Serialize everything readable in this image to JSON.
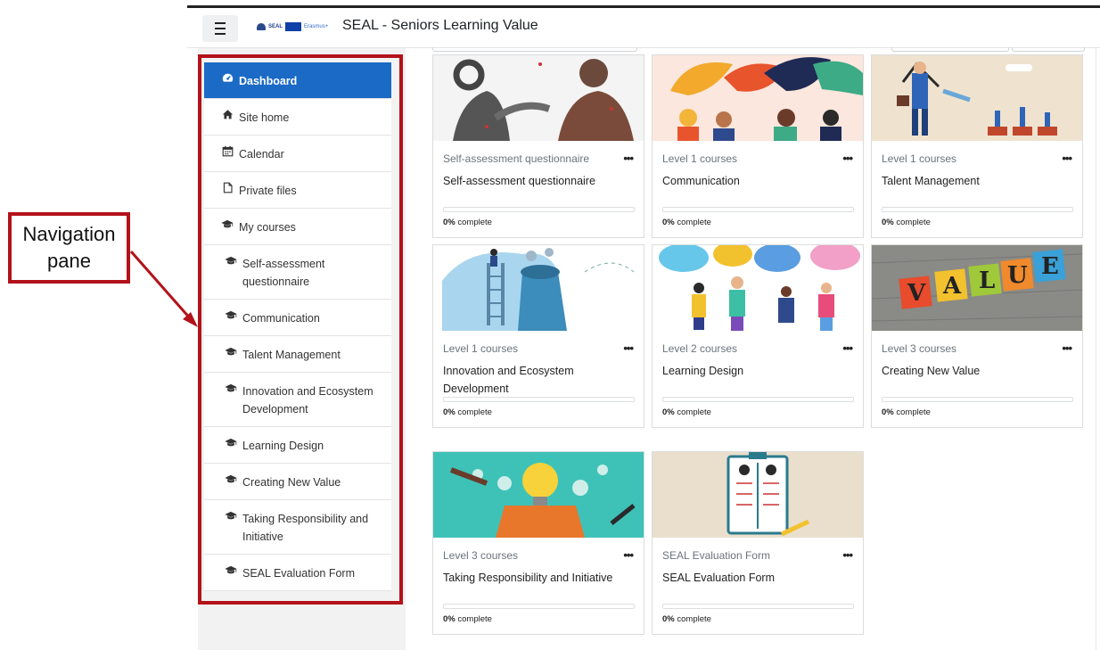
{
  "annotation": {
    "label": "Navigation\npane"
  },
  "header": {
    "menu_icon": "hamburger-icon",
    "site_title": "SEAL - Seniors Learning Value",
    "logo_text_1": "SEAL",
    "logo_text_2": "Erasmus+"
  },
  "nav": {
    "items": [
      {
        "label": "Dashboard",
        "icon": "dashboard-icon",
        "active": true
      },
      {
        "label": "Site home",
        "icon": "home-icon"
      },
      {
        "label": "Calendar",
        "icon": "calendar-icon"
      },
      {
        "label": "Private files",
        "icon": "file-icon"
      },
      {
        "label": "My courses",
        "icon": "graduation-cap-icon"
      },
      {
        "label": "Self-assessment questionnaire",
        "icon": "graduation-cap-icon"
      },
      {
        "label": "Communication",
        "icon": "graduation-cap-icon"
      },
      {
        "label": "Talent Management",
        "icon": "graduation-cap-icon"
      },
      {
        "label": "Innovation and Ecosystem Development",
        "icon": "graduation-cap-icon"
      },
      {
        "label": "Learning Design",
        "icon": "graduation-cap-icon"
      },
      {
        "label": "Creating New Value",
        "icon": "graduation-cap-icon"
      },
      {
        "label": "Taking Responsibility and Initiative",
        "icon": "graduation-cap-icon"
      },
      {
        "label": "SEAL Evaluation Form",
        "icon": "graduation-cap-icon"
      }
    ]
  },
  "courses": [
    {
      "category": "Self-assessment questionnaire",
      "name": "Self-assessment questionnaire",
      "progress_pct": 0,
      "percent_text": "0%",
      "complete_text": " complete",
      "menu": "•••"
    },
    {
      "category": "Level 1 courses",
      "name": "Communication",
      "progress_pct": 0,
      "percent_text": "0%",
      "complete_text": " complete",
      "menu": "•••"
    },
    {
      "category": "Level 1 courses",
      "name": "Talent Management",
      "progress_pct": 0,
      "percent_text": "0%",
      "complete_text": " complete",
      "menu": "•••"
    },
    {
      "category": "Level 1 courses",
      "name": "Innovation and Ecosystem Development",
      "progress_pct": 0,
      "percent_text": "0%",
      "complete_text": " complete",
      "menu": "•••"
    },
    {
      "category": "Level 2 courses",
      "name": "Learning Design",
      "progress_pct": 0,
      "percent_text": "0%",
      "complete_text": " complete",
      "menu": "•••"
    },
    {
      "category": "Level 3 courses",
      "name": "Creating New Value",
      "progress_pct": 0,
      "percent_text": "0%",
      "complete_text": " complete",
      "menu": "•••"
    },
    {
      "category": "Level 3 courses",
      "name": "Taking Responsibility and Initiative",
      "progress_pct": 0,
      "percent_text": "0%",
      "complete_text": " complete",
      "menu": "•••"
    },
    {
      "category": "SEAL Evaluation Form",
      "name": "SEAL Evaluation Form",
      "progress_pct": 0,
      "percent_text": "0%",
      "complete_text": " complete",
      "menu": "•••"
    }
  ],
  "colors": {
    "accent": "#1a6ac6",
    "annotation": "#b3121a"
  }
}
